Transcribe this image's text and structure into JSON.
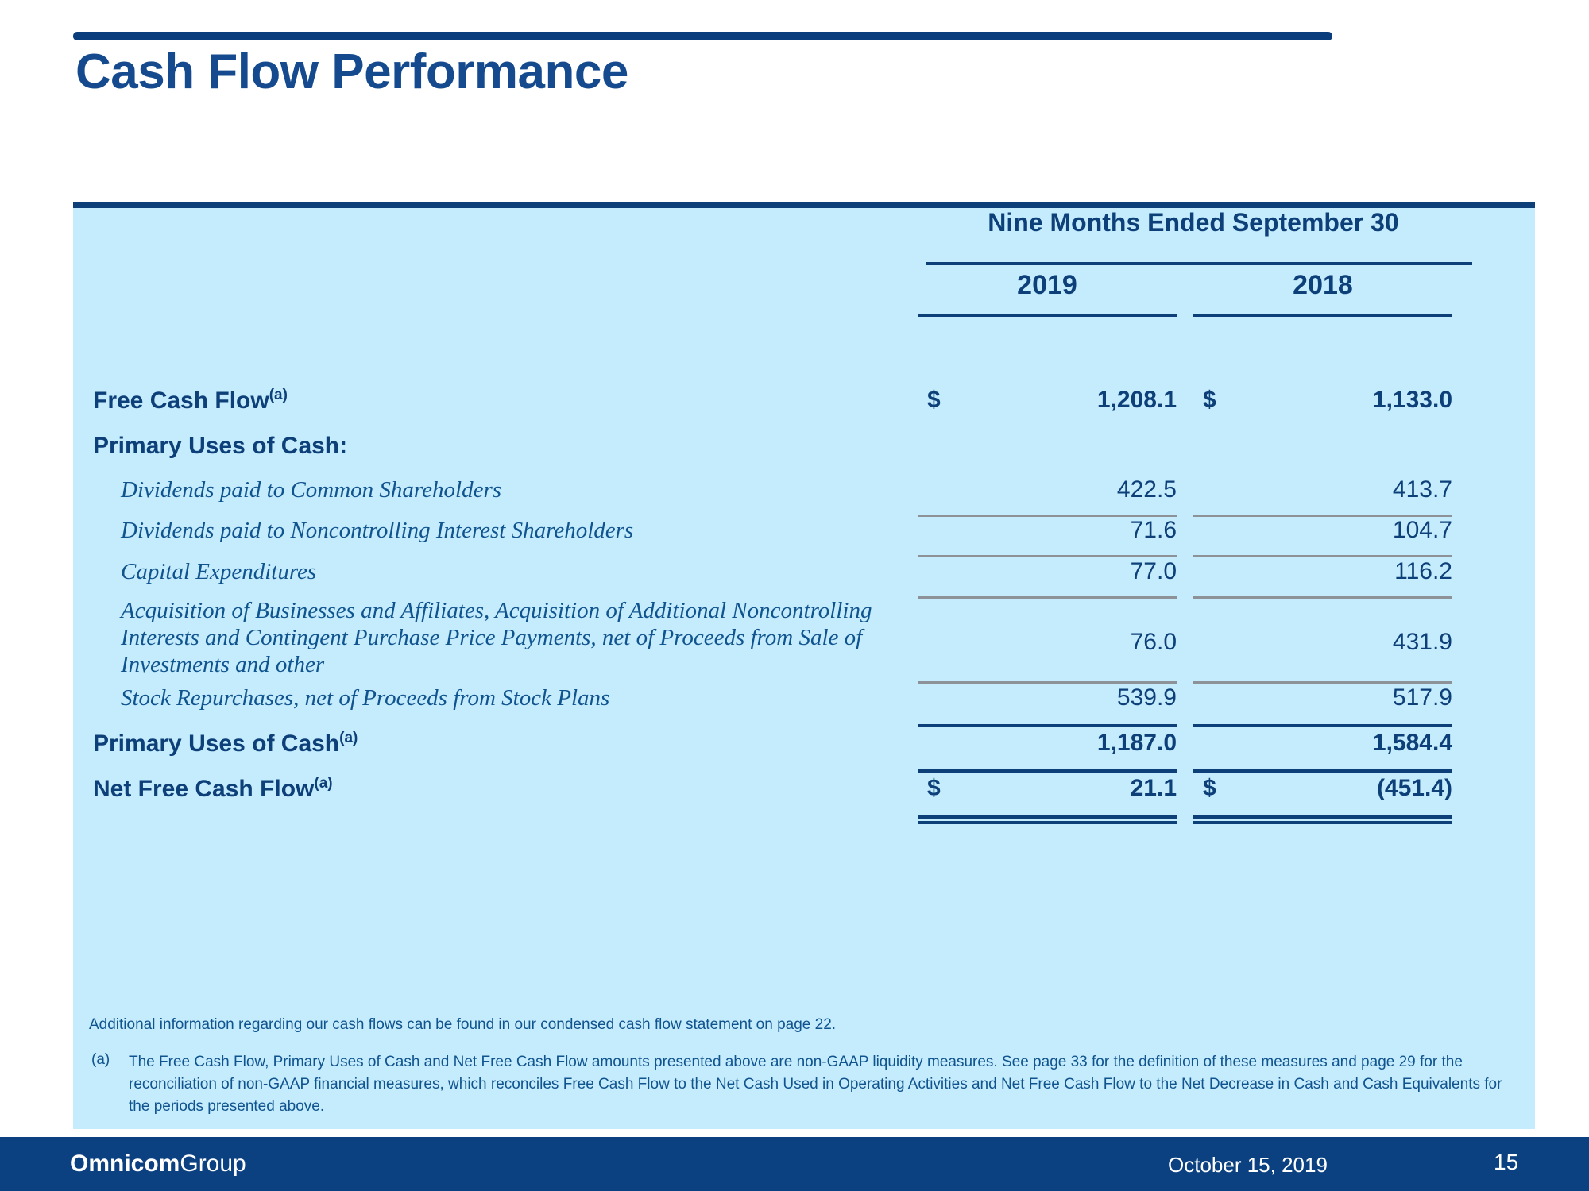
{
  "slide": {
    "title": "Cash Flow Performance"
  },
  "table": {
    "group_header": "Nine Months Ended September 30",
    "year_2019": "2019",
    "year_2018": "2018",
    "rows": {
      "free_cash_flow": {
        "label": "Free Cash Flow",
        "footnote_marker": "(a)",
        "currency_2019": "$",
        "value_2019": "1,208.1",
        "currency_2018": "$",
        "value_2018": "1,133.0"
      },
      "primary_uses_heading": {
        "label": "Primary Uses of Cash:"
      },
      "dividends_common": {
        "label": "Dividends paid to Common Shareholders",
        "value_2019": "422.5",
        "value_2018": "413.7"
      },
      "dividends_noncontrolling": {
        "label": "Dividends paid to Noncontrolling Interest Shareholders",
        "value_2019": "71.6",
        "value_2018": "104.7"
      },
      "capital_expenditures": {
        "label": "Capital Expenditures",
        "value_2019": "77.0",
        "value_2018": "116.2"
      },
      "acquisitions": {
        "label": "Acquisition of Businesses and Affiliates, Acquisition of Additional Noncontrolling Interests and Contingent Purchase Price Payments, net of Proceeds from Sale of Investments and other",
        "value_2019": "76.0",
        "value_2018": "431.9"
      },
      "stock_repurchases": {
        "label": "Stock Repurchases, net of Proceeds from Stock Plans",
        "value_2019": "539.9",
        "value_2018": "517.9"
      },
      "primary_uses_total": {
        "label": "Primary Uses of Cash",
        "footnote_marker": "(a)",
        "value_2019": "1,187.0",
        "value_2018": "1,584.4"
      },
      "net_free_cash_flow": {
        "label": "Net Free Cash Flow",
        "footnote_marker": "(a)",
        "currency_2019": "$",
        "value_2019": "21.1",
        "currency_2018": "$",
        "value_2018": "(451.4)"
      }
    }
  },
  "footnotes": {
    "main": "Additional information regarding our cash flows can be found in our condensed cash flow statement on page 22.",
    "marker_a": "(a)",
    "note_a": "The Free Cash Flow, Primary Uses of Cash and Net Free Cash Flow amounts presented above are non-GAAP liquidity measures. See page 33 for the definition of these measures and page 29 for the reconciliation of non-GAAP financial measures, which reconciles Free Cash Flow to the Net Cash Used in Operating Activities and Net Free Cash Flow to the Net Decrease in Cash and Cash Equivalents for the periods presented above."
  },
  "footer": {
    "logo_bold": "Omnicom",
    "logo_light": "Group",
    "date": "October 15, 2019",
    "page_number": "15"
  },
  "colors": {
    "navy": "#0d3f79",
    "title_blue": "#154b8e",
    "panel_bg": "#c5ecfd",
    "italic_blue": "#10548f",
    "separator_gray": "#8c9298",
    "footer_bg": "#0c4181"
  }
}
